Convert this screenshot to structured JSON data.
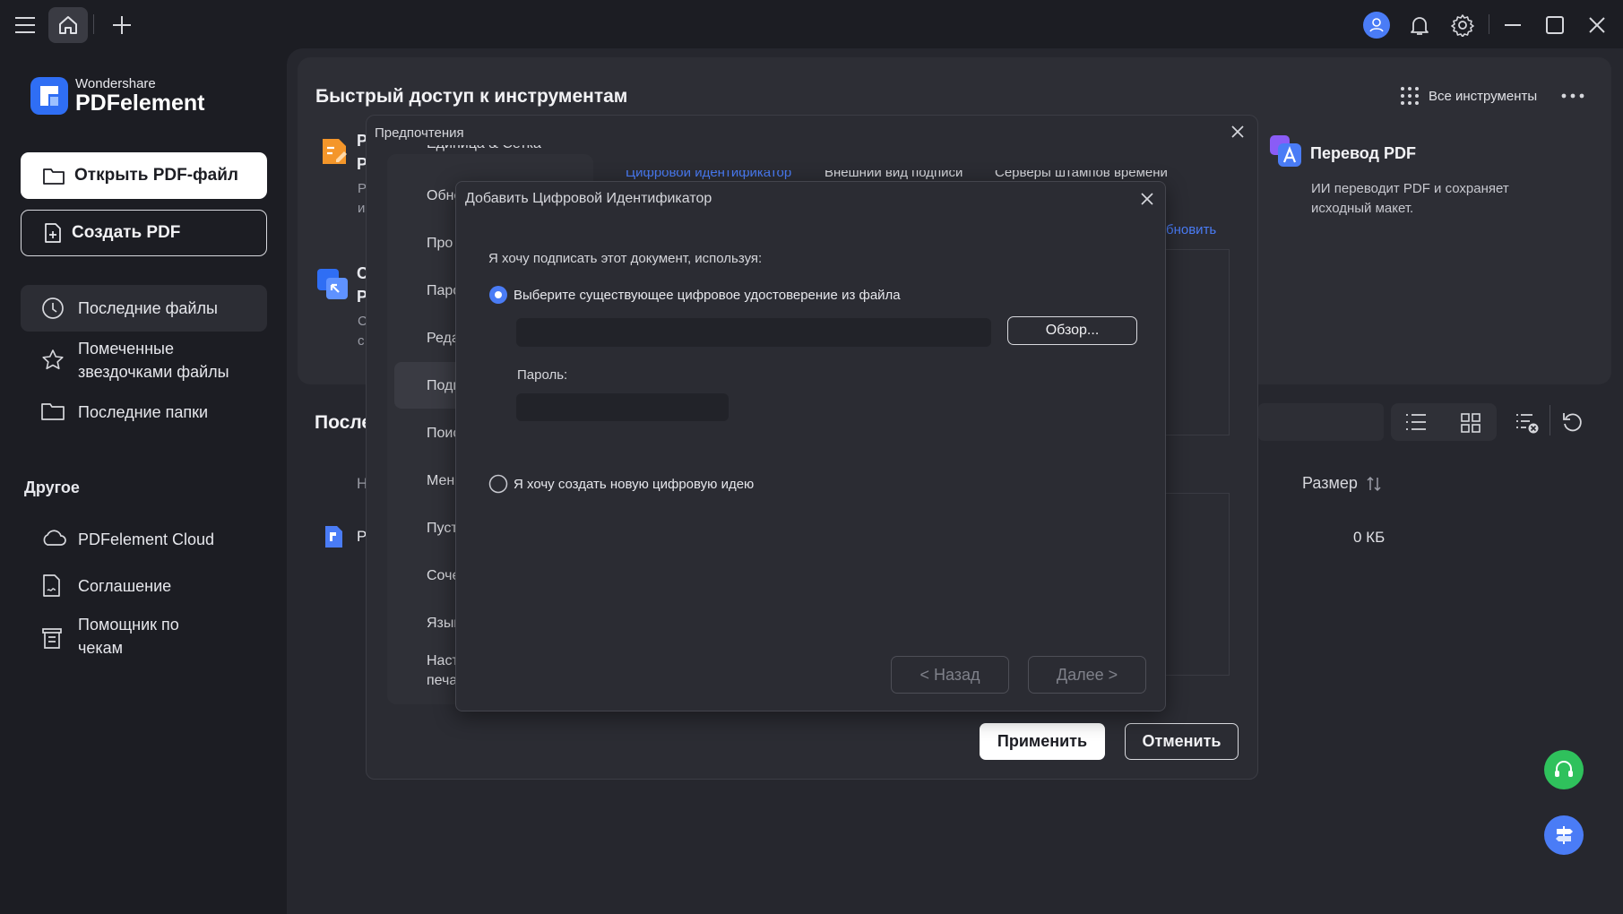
{
  "app": {
    "brand_top": "Wondershare",
    "brand_name": "PDFelement"
  },
  "sidebar": {
    "open_pdf": "Открыть PDF-файл",
    "create_pdf": "Создать PDF",
    "nav": [
      {
        "label": "Последние файлы"
      },
      {
        "label_line1": "Помеченные",
        "label_line2": "звездочками файлы"
      },
      {
        "label": "Последние папки"
      }
    ],
    "other_heading": "Другое",
    "other": [
      {
        "label": "PDFelement Cloud"
      },
      {
        "label": "Соглашение"
      },
      {
        "label_line1": "Помощник по",
        "label_line2": "чекам"
      }
    ]
  },
  "quick_access": {
    "title": "Быстрый доступ к инструментам",
    "all_tools": "Все инструменты",
    "translate": {
      "title": "Перевод PDF",
      "desc_line1": "ИИ переводит PDF и сохраняет",
      "desc_line2": "исходный макет."
    },
    "card1_frag": [
      "Р",
      "Р",
      "Р",
      "и"
    ],
    "card2_frag": [
      "С",
      "Р",
      "С",
      "с"
    ]
  },
  "recent": {
    "heading_frag": "После",
    "col_name_frag": "Н",
    "col_size": "Размер",
    "row_name_frag": "Р",
    "row_size": "0 КБ"
  },
  "preferences": {
    "title": "Предпочтения",
    "nav_top_partial": "Единица & Сетка",
    "nav_items": [
      "Обно",
      "Про",
      "Паро",
      "Реда",
      "Подп",
      "Поис",
      "Мен",
      "Пуст",
      "Соче",
      "Язык",
      "Наст",
      "печа"
    ],
    "tabs": [
      "Цифровой идентификатор",
      "Внешний вид подписи",
      "Серверы штампов времени"
    ],
    "refresh_link": "бновить",
    "apply": "Применить",
    "cancel": "Отменить"
  },
  "add_id_dialog": {
    "title": "Добавить Цифровой Идентификатор",
    "prompt": "Я хочу подписать этот документ, используя:",
    "option_existing": "Выберите существующее цифровое удостоверение из файла",
    "browse": "Обзор...",
    "file_path_value": "",
    "password_label": "Пароль:",
    "password_value": "",
    "option_new": "Я хочу создать новую цифровую идею",
    "back": "< Назад",
    "next": "Далее >",
    "selected_option": "existing"
  },
  "colors": {
    "accent_blue": "#4a7cf6",
    "support_green": "#2fc15c",
    "orange": "#f4962a"
  }
}
